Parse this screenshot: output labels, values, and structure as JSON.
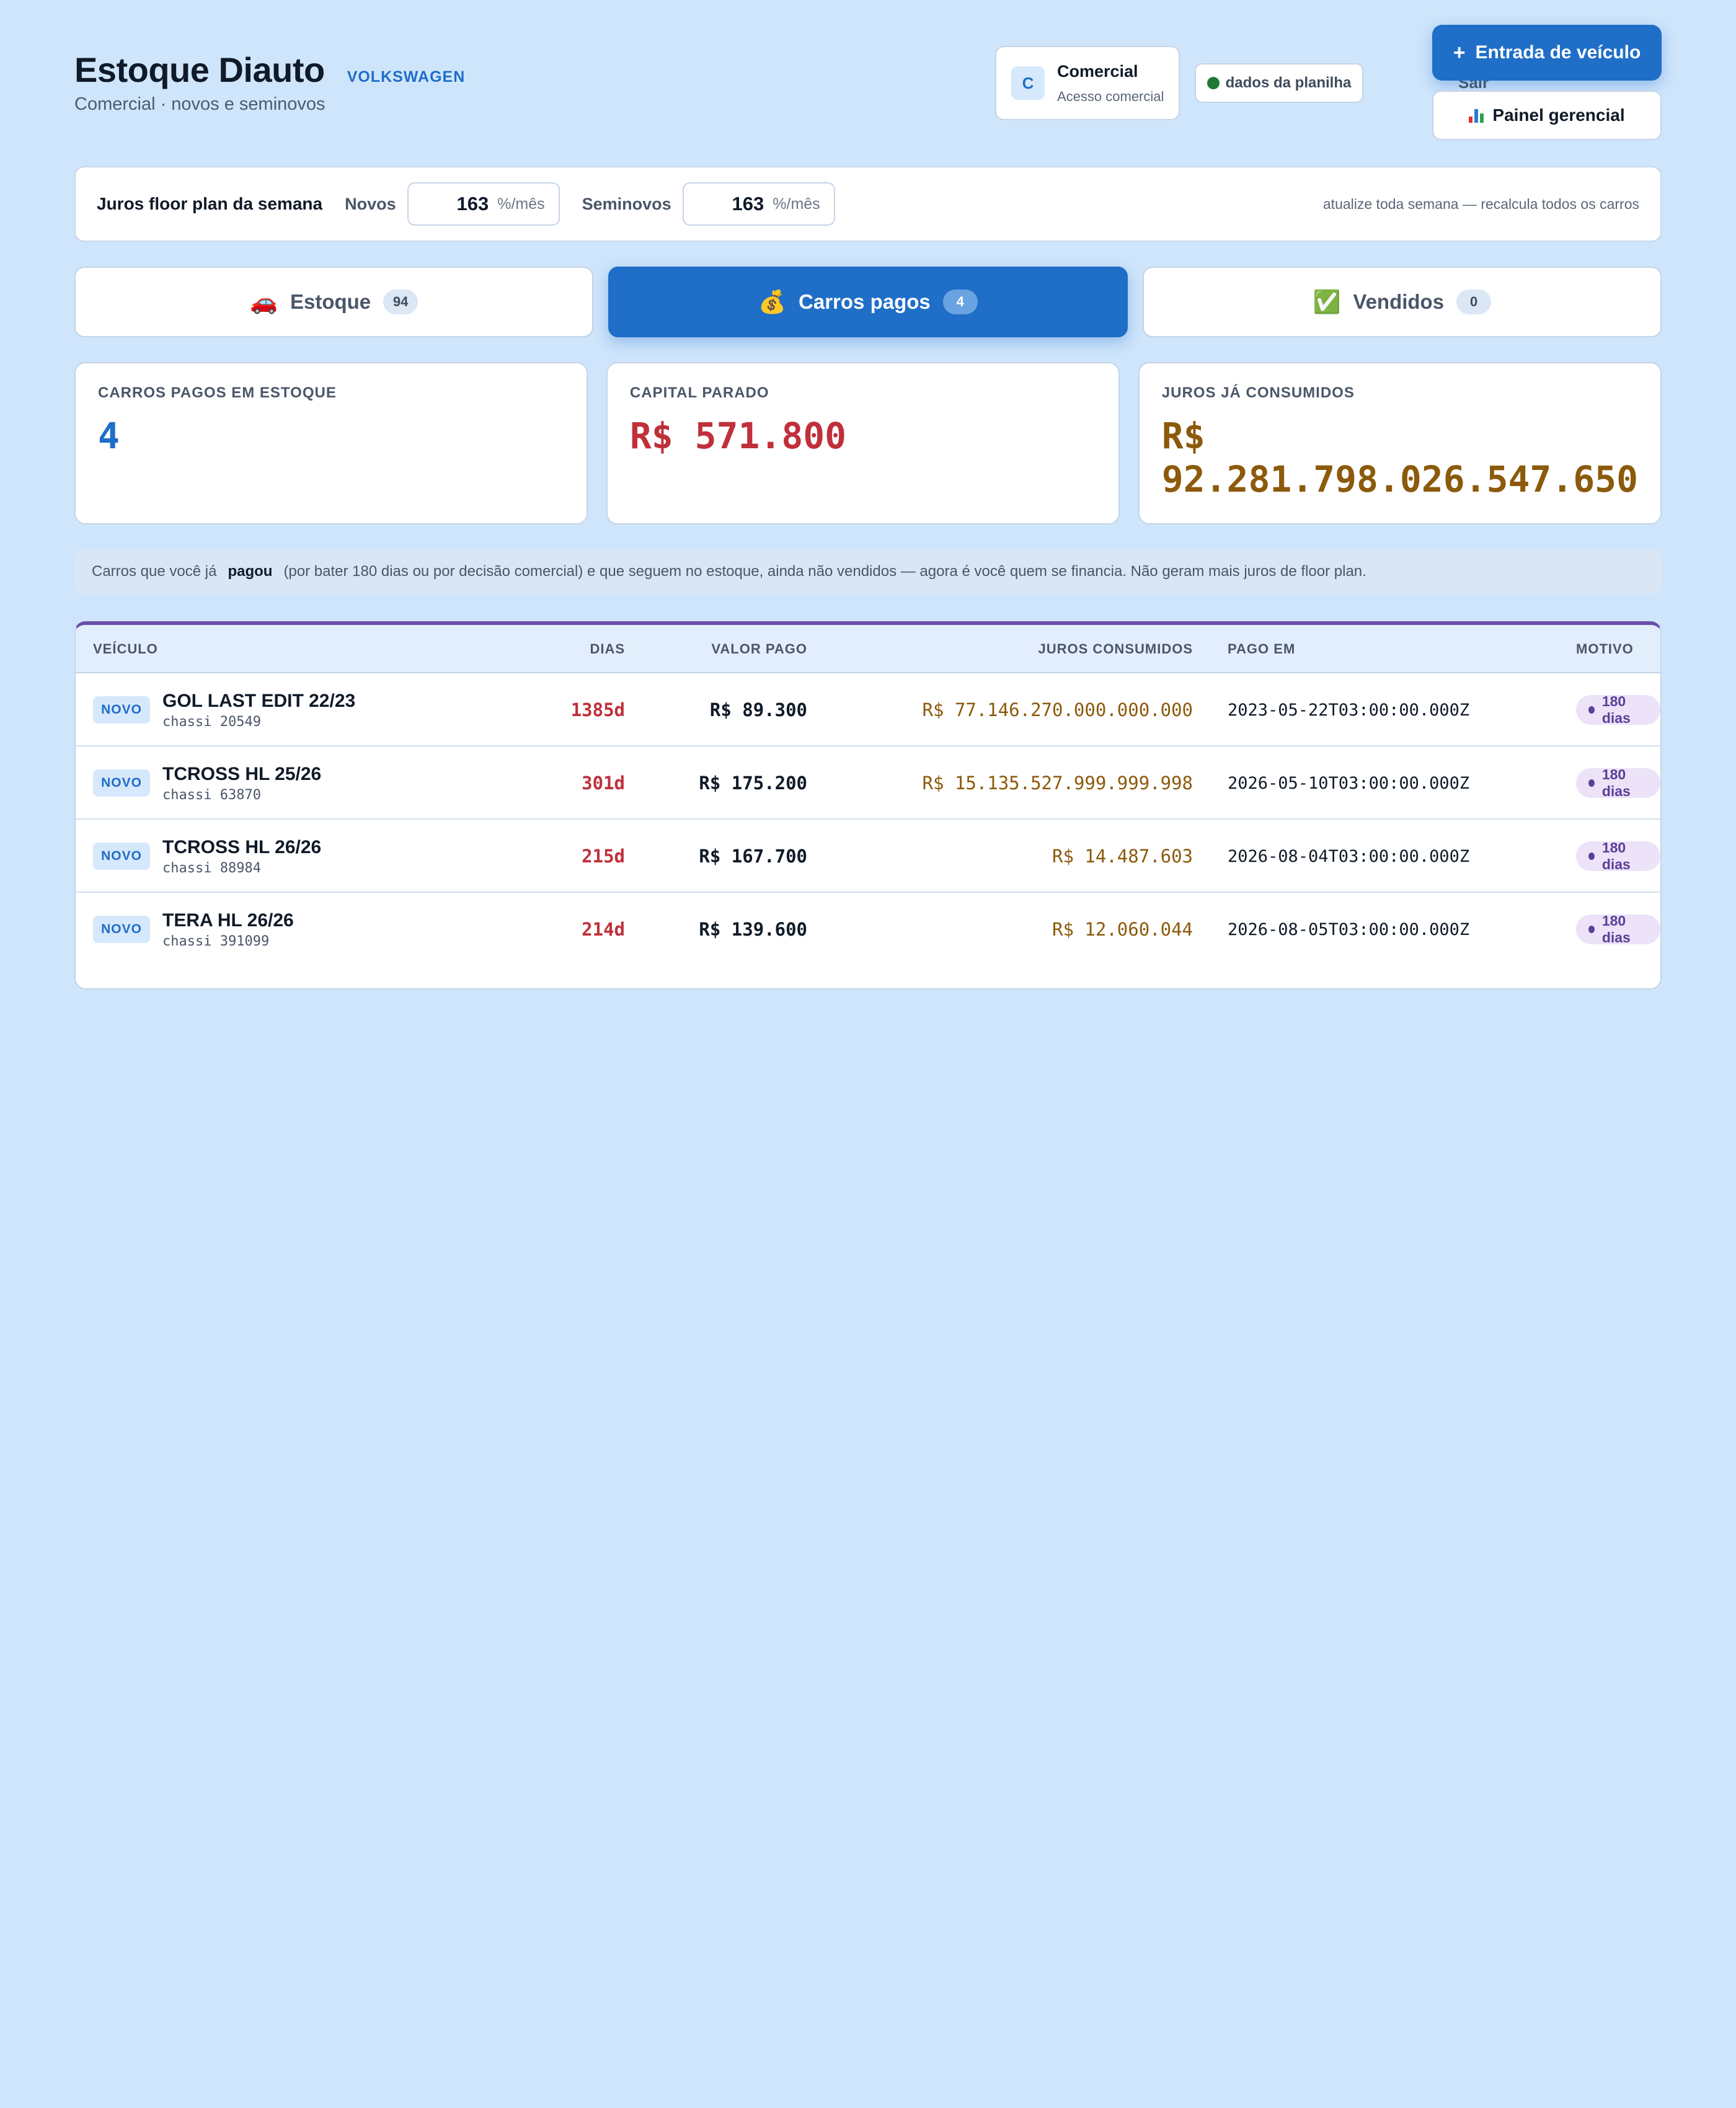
{
  "header": {
    "title": "Estoque Diauto",
    "brand": "VOLKSWAGEN",
    "subtitle": "Comercial · novos e seminovos",
    "user": {
      "initial": "C",
      "name": "Comercial",
      "role": "Acesso comercial"
    },
    "sheet_status": "dados da planilha",
    "logout": "Sair",
    "primary_button": "Entrada de veículo",
    "secondary_button": "Painel gerencial"
  },
  "interest": {
    "title": "Juros floor plan da semana",
    "novos_label": "Novos",
    "novos_value": "163",
    "seminovos_label": "Seminovos",
    "seminovos_value": "163",
    "unit": "%/mês",
    "note": "atualize toda semana — recalcula todos os carros"
  },
  "tabs": [
    {
      "emoji": "🚗",
      "label": "Estoque",
      "count": "94",
      "active": false
    },
    {
      "emoji": "💰",
      "label": "Carros pagos",
      "count": "4",
      "active": true
    },
    {
      "emoji": "✅",
      "label": "Vendidos",
      "count": "0",
      "active": false
    }
  ],
  "stats": [
    {
      "label": "CARROS PAGOS EM ESTOQUE",
      "value": "4",
      "color": "#1f6ec8"
    },
    {
      "label": "CAPITAL PARADO",
      "value": "R$ 571.800",
      "color": "#c0303a"
    },
    {
      "label": "JUROS JÁ CONSUMIDOS",
      "value": "R$ 92.281.798.026.547.650",
      "color": "#8c5a0b"
    }
  ],
  "info": {
    "before": "Carros que você já",
    "bold": "pagou",
    "after": "(por bater 180 dias ou por decisão comercial) e que seguem no estoque, ainda não vendidos — agora é você quem se financia. Não geram mais juros de floor plan."
  },
  "table": {
    "columns": [
      "VEÍCULO",
      "DIAS",
      "VALOR PAGO",
      "JUROS CONSUMIDOS",
      "PAGO EM",
      "MOTIVO"
    ],
    "rows": [
      {
        "tag": "NOVO",
        "name": "GOL LAST EDIT 22/23",
        "chassi": "chassi 20549",
        "dias": "1385d",
        "valor": "R$ 89.300",
        "juros": "R$ 77.146.270.000.000.000",
        "pago_em": "2023-05-22T03:00:00.000Z",
        "motivo": "180 dias"
      },
      {
        "tag": "NOVO",
        "name": "TCROSS HL 25/26",
        "chassi": "chassi 63870",
        "dias": "301d",
        "valor": "R$ 175.200",
        "juros": "R$ 15.135.527.999.999.998",
        "pago_em": "2026-05-10T03:00:00.000Z",
        "motivo": "180 dias"
      },
      {
        "tag": "NOVO",
        "name": "TCROSS HL 26/26",
        "chassi": "chassi 88984",
        "dias": "215d",
        "valor": "R$ 167.700",
        "juros": "R$ 14.487.603",
        "pago_em": "2026-08-04T03:00:00.000Z",
        "motivo": "180 dias"
      },
      {
        "tag": "NOVO",
        "name": "TERA HL 26/26",
        "chassi": "chassi 391099",
        "dias": "214d",
        "valor": "R$ 139.600",
        "juros": "R$ 12.060.044",
        "pago_em": "2026-08-05T03:00:00.000Z",
        "motivo": "180 dias"
      }
    ]
  },
  "colors": {
    "background": "#cfe5fb",
    "accent": "#1f6ec8",
    "danger": "#c0303a",
    "interest": "#8c5a0b",
    "motivo": "#5c3f97",
    "status_ok": "#1e7a36"
  }
}
